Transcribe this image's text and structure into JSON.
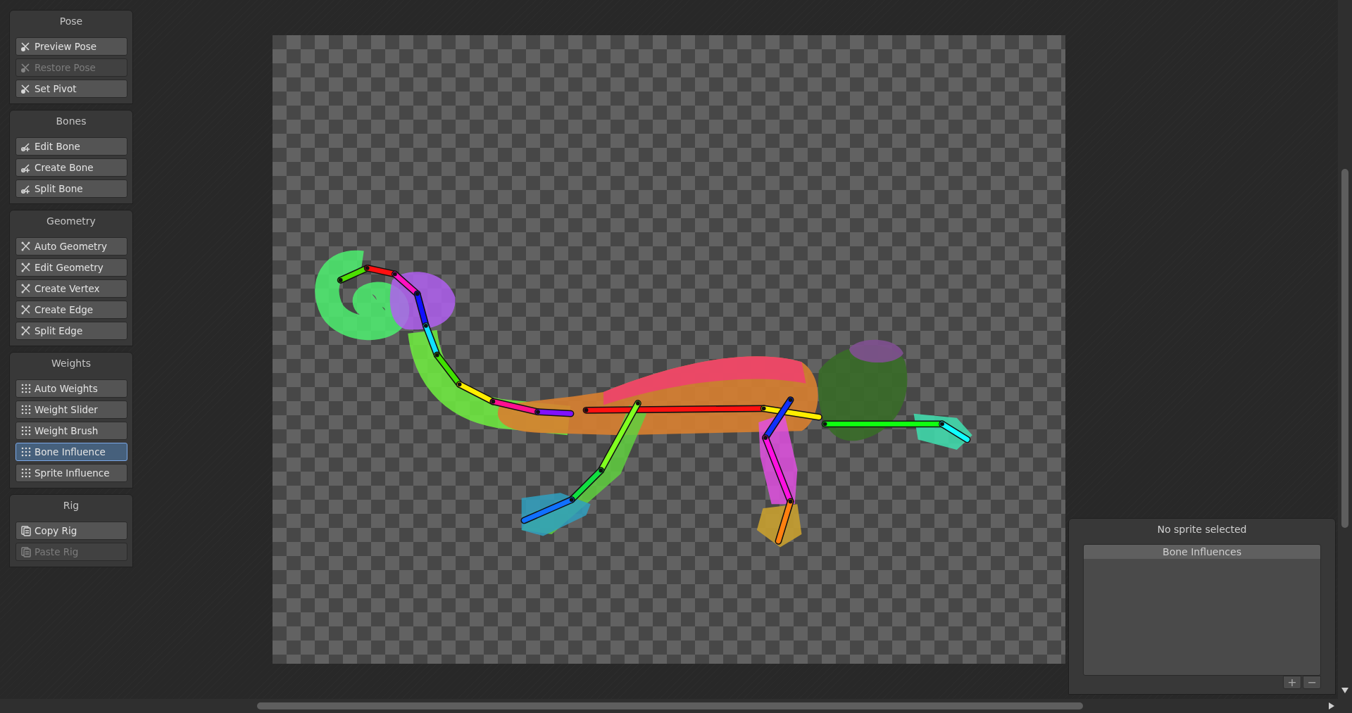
{
  "tool_groups": [
    {
      "title": "Pose",
      "buttons": [
        {
          "label": "Preview Pose",
          "disabled": false,
          "selected": false
        },
        {
          "label": "Restore Pose",
          "disabled": true,
          "selected": false
        },
        {
          "label": "Set Pivot",
          "disabled": false,
          "selected": false
        }
      ]
    },
    {
      "title": "Bones",
      "buttons": [
        {
          "label": "Edit Bone",
          "disabled": false,
          "selected": false
        },
        {
          "label": "Create Bone",
          "disabled": false,
          "selected": false
        },
        {
          "label": "Split Bone",
          "disabled": false,
          "selected": false
        }
      ]
    },
    {
      "title": "Geometry",
      "buttons": [
        {
          "label": "Auto Geometry",
          "disabled": false,
          "selected": false
        },
        {
          "label": "Edit Geometry",
          "disabled": false,
          "selected": false
        },
        {
          "label": "Create Vertex",
          "disabled": false,
          "selected": false
        },
        {
          "label": "Create Edge",
          "disabled": false,
          "selected": false
        },
        {
          "label": "Split Edge",
          "disabled": false,
          "selected": false
        }
      ]
    },
    {
      "title": "Weights",
      "buttons": [
        {
          "label": "Auto Weights",
          "disabled": false,
          "selected": false
        },
        {
          "label": "Weight Slider",
          "disabled": false,
          "selected": false
        },
        {
          "label": "Weight Brush",
          "disabled": false,
          "selected": false
        },
        {
          "label": "Bone Influence",
          "disabled": false,
          "selected": true
        },
        {
          "label": "Sprite Influence",
          "disabled": false,
          "selected": false
        }
      ]
    },
    {
      "title": "Rig",
      "buttons": [
        {
          "label": "Copy Rig",
          "disabled": false,
          "selected": false
        },
        {
          "label": "Paste Rig",
          "disabled": true,
          "selected": false
        }
      ]
    }
  ],
  "inspector": {
    "title": "No sprite selected",
    "list": {
      "header": "Bone Influences",
      "buttons": [
        "+",
        "−"
      ]
    }
  }
}
